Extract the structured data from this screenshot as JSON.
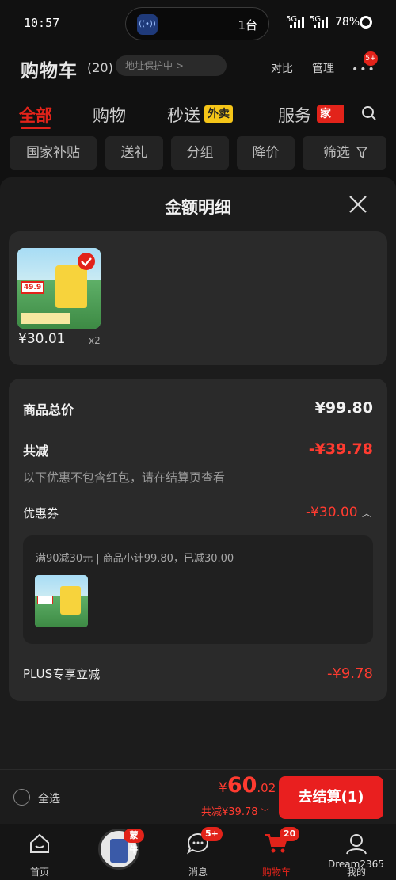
{
  "status_bar": {
    "time": "10:57",
    "island_count": "1台",
    "signal_1": "5G",
    "signal_2": "5G",
    "battery": "78%"
  },
  "header": {
    "title": "购物车",
    "count": "(20)",
    "address_hint": "地址保护中 >",
    "compare": "对比",
    "manage": "管理",
    "more_badge": "5+"
  },
  "tabs": [
    {
      "label": "全部",
      "active": true
    },
    {
      "label": "购物"
    },
    {
      "label": "秒送",
      "tag": "外卖"
    },
    {
      "label": "服务",
      "tag": "家政"
    }
  ],
  "chips": [
    "国家补贴",
    "送礼",
    "分组",
    "降价",
    "筛选"
  ],
  "modal": {
    "title": "金额明细",
    "product": {
      "price": "¥30.01",
      "qty": "x2",
      "img_promo": "49.9"
    },
    "summary": {
      "total_label": "商品总价",
      "total_value": "¥99.80",
      "reduce_label": "共减",
      "reduce_value": "-¥39.78",
      "note": "以下优惠不包含红包，请在结算页查看",
      "coupon_label": "优惠券",
      "coupon_value": "-¥30.00",
      "coupon_detail": "满90减30元 | 商品小计99.80，已减30.00",
      "plus_label": "PLUS专享立减",
      "plus_value": "-¥9.78"
    }
  },
  "bottom_bar": {
    "select_all": "全选",
    "total_yen": "¥",
    "total_int": "60",
    "total_dec": ".02",
    "reduce_text": "共减¥39.78",
    "checkout": "去结算(1)"
  },
  "nav": [
    {
      "label": "首页",
      "icon": "home-icon"
    },
    {
      "label": "",
      "icon": "mengniu-avatar",
      "badge": "蒙牛"
    },
    {
      "label": "消息",
      "icon": "message-icon",
      "badge": "5+"
    },
    {
      "label": "购物车",
      "icon": "cart-icon",
      "badge": "20",
      "active": true
    },
    {
      "label": "我的",
      "icon": "profile-icon"
    }
  ],
  "watermark": "Dream2365",
  "colors": {
    "accent": "#e2231a",
    "price_red": "#ff3b30",
    "background": "#111111",
    "sheet": "#1c1c1c",
    "card": "#2a2a2a"
  }
}
